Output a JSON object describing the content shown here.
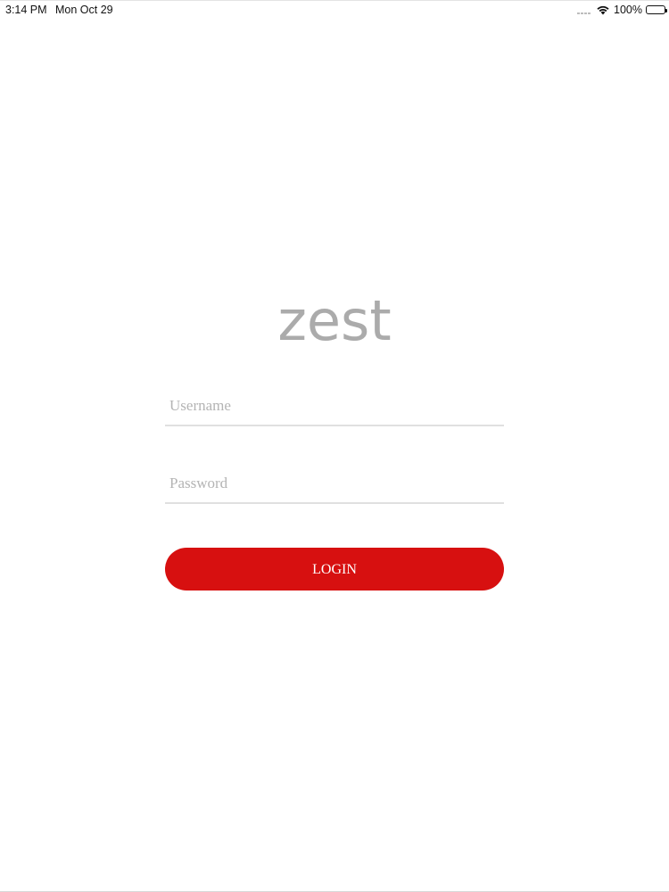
{
  "status_bar": {
    "time": "3:14 PM",
    "date": "Mon Oct 29",
    "battery": "100%",
    "icons": [
      "cellular-signal-icon",
      "wifi-icon",
      "battery-icon"
    ]
  },
  "logo": {
    "text": "zest",
    "color": "#ababab"
  },
  "form": {
    "username": {
      "value": "",
      "placeholder": "Username"
    },
    "password": {
      "value": "",
      "placeholder": "Password"
    },
    "login_label": "LOGIN"
  },
  "colors": {
    "accent": "#d71010",
    "field_underline": "#e0e0e0",
    "placeholder": "#b4b4b4"
  }
}
